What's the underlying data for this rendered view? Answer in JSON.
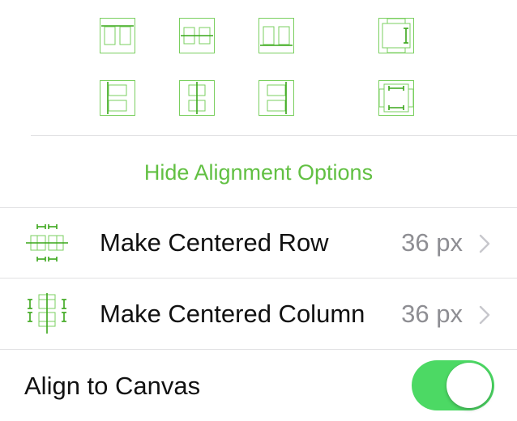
{
  "colors": {
    "accent": "#62c043",
    "icon_stroke": "#7acf5f",
    "icon_line": "#3aa71a",
    "toggle_on": "#4cd964",
    "separator": "#e1e1e3",
    "value_text": "#8e8e93"
  },
  "alignment_grid": {
    "row1": [
      {
        "icon": "align-top-edges-icon"
      },
      {
        "icon": "align-vertical-centers-icon"
      },
      {
        "icon": "align-bottom-edges-icon"
      },
      {
        "icon": "distribute-vertical-spacing-icon"
      }
    ],
    "row2": [
      {
        "icon": "align-left-edges-icon"
      },
      {
        "icon": "align-horizontal-centers-icon"
      },
      {
        "icon": "align-right-edges-icon"
      },
      {
        "icon": "distribute-horizontal-spacing-icon"
      }
    ]
  },
  "hide_alignment": {
    "label": "Hide Alignment Options"
  },
  "rows": [
    {
      "icon": "centered-row-icon",
      "label": "Make Centered Row",
      "value": "36 px"
    },
    {
      "icon": "centered-column-icon",
      "label": "Make Centered Column",
      "value": "36 px"
    }
  ],
  "align_to_canvas": {
    "label": "Align to Canvas",
    "enabled": true
  }
}
